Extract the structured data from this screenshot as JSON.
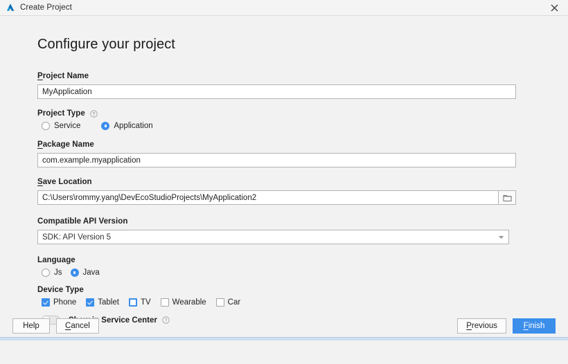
{
  "window": {
    "title": "Create Project",
    "logo_icon": "deveco-triangle-logo",
    "close_icon": "close-icon"
  },
  "page": {
    "heading": "Configure your project"
  },
  "fields": {
    "project_name": {
      "label": "Project Name",
      "mnemonic": "P",
      "value": "MyApplication"
    },
    "project_type": {
      "label": "Project Type",
      "mnemonic": "",
      "help_icon": "help-circle-icon",
      "options": [
        {
          "label": "Service",
          "selected": false
        },
        {
          "label": "Application",
          "selected": true
        }
      ]
    },
    "package_name": {
      "label": "Package Name",
      "mnemonic": "P",
      "value": "com.example.myapplication"
    },
    "save_location": {
      "label": "Save Location",
      "mnemonic": "S",
      "value": "C:\\Users\\rommy.yang\\DevEcoStudioProjects\\MyApplication2",
      "browse_icon": "folder-icon"
    },
    "api_version": {
      "label": "Compatible API Version",
      "value": "SDK: API Version 5",
      "arrow_icon": "chevron-down-icon"
    },
    "language": {
      "label": "Language",
      "options": [
        {
          "label": "Js",
          "selected": false
        },
        {
          "label": "Java",
          "selected": true
        }
      ]
    },
    "device_type": {
      "label": "Device Type",
      "options": [
        {
          "label": "Phone",
          "checked": true,
          "focused": false
        },
        {
          "label": "Tablet",
          "checked": true,
          "focused": false
        },
        {
          "label": "TV",
          "checked": false,
          "focused": true
        },
        {
          "label": "Wearable",
          "checked": false,
          "focused": false
        },
        {
          "label": "Car",
          "checked": false,
          "focused": false
        }
      ]
    },
    "service_center": {
      "label": "Show in Service Center",
      "enabled": false,
      "help_icon": "help-circle-icon"
    }
  },
  "footer": {
    "help_label": "Help",
    "cancel_label": "Cancel",
    "cancel_mnemonic": "C",
    "previous_label": "Previous",
    "previous_mnemonic": "P",
    "finish_label": "Finish",
    "finish_mnemonic": "F"
  },
  "colors": {
    "accent": "#3c8eeb",
    "background": "#f2f2f2",
    "field_border": "#b4b4b4",
    "text": "#1f1f1f"
  }
}
